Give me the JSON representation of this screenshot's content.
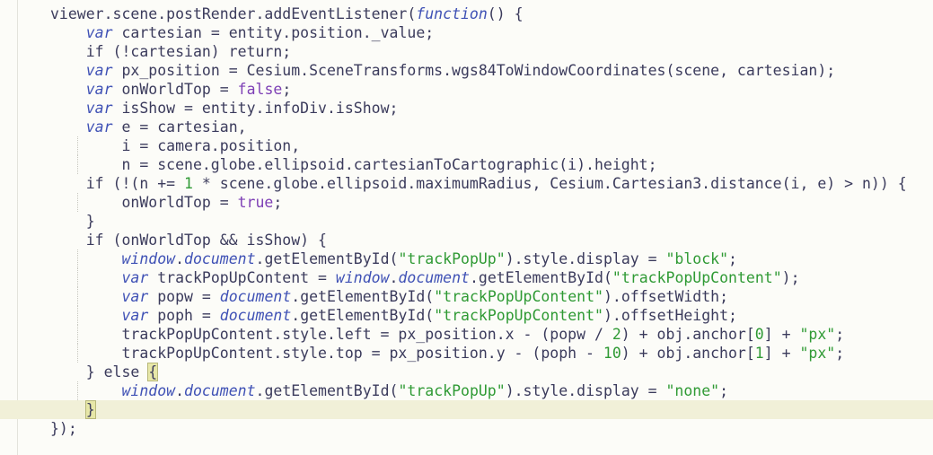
{
  "editor": {
    "lines": [
      [
        {
          "t": "plain",
          "s": "viewer.scene.postRender.addEventListener("
        },
        {
          "t": "kw",
          "s": "function"
        },
        {
          "t": "plain",
          "s": "() {"
        }
      ],
      [
        {
          "t": "plain",
          "s": "    "
        },
        {
          "t": "kw",
          "s": "var"
        },
        {
          "t": "plain",
          "s": " cartesian = entity.position._value;"
        }
      ],
      [
        {
          "t": "plain",
          "s": "    if (!cartesian) return;"
        }
      ],
      [
        {
          "t": "plain",
          "s": "    "
        },
        {
          "t": "kw",
          "s": "var"
        },
        {
          "t": "plain",
          "s": " px_position = Cesium.SceneTransforms.wgs84ToWindowCoordinates(scene, cartesian);"
        }
      ],
      [
        {
          "t": "plain",
          "s": "    "
        },
        {
          "t": "kw",
          "s": "var"
        },
        {
          "t": "plain",
          "s": " onWorldTop = "
        },
        {
          "t": "bool",
          "s": "false"
        },
        {
          "t": "plain",
          "s": ";"
        }
      ],
      [
        {
          "t": "plain",
          "s": "    "
        },
        {
          "t": "kw",
          "s": "var"
        },
        {
          "t": "plain",
          "s": " isShow = entity.infoDiv.isShow;"
        }
      ],
      [
        {
          "t": "plain",
          "s": "    "
        },
        {
          "t": "kw",
          "s": "var"
        },
        {
          "t": "plain",
          "s": " e = cartesian,"
        }
      ],
      [
        {
          "t": "plain",
          "s": "        i = camera.position,"
        }
      ],
      [
        {
          "t": "plain",
          "s": "        n = scene.globe.ellipsoid.cartesianToCartographic(i).height;"
        }
      ],
      [
        {
          "t": "plain",
          "s": "    if (!(n += "
        },
        {
          "t": "num",
          "s": "1"
        },
        {
          "t": "plain",
          "s": " * scene.globe.ellipsoid.maximumRadius, Cesium.Cartesian3.distance(i, e) > n)) {"
        }
      ],
      [
        {
          "t": "plain",
          "s": "        onWorldTop = "
        },
        {
          "t": "bool",
          "s": "true"
        },
        {
          "t": "plain",
          "s": ";"
        }
      ],
      [
        {
          "t": "plain",
          "s": "    }"
        }
      ],
      [
        {
          "t": "plain",
          "s": "    if (onWorldTop && isShow) {"
        }
      ],
      [
        {
          "t": "plain",
          "s": "        "
        },
        {
          "t": "obj",
          "s": "window"
        },
        {
          "t": "plain",
          "s": "."
        },
        {
          "t": "obj",
          "s": "document"
        },
        {
          "t": "plain",
          "s": ".getElementById("
        },
        {
          "t": "str",
          "s": "\"trackPopUp\""
        },
        {
          "t": "plain",
          "s": ").style.display = "
        },
        {
          "t": "str",
          "s": "\"block\""
        },
        {
          "t": "plain",
          "s": ";"
        }
      ],
      [
        {
          "t": "plain",
          "s": "        "
        },
        {
          "t": "kw",
          "s": "var"
        },
        {
          "t": "plain",
          "s": " trackPopUpContent = "
        },
        {
          "t": "obj",
          "s": "window"
        },
        {
          "t": "plain",
          "s": "."
        },
        {
          "t": "obj",
          "s": "document"
        },
        {
          "t": "plain",
          "s": ".getElementById("
        },
        {
          "t": "str",
          "s": "\"trackPopUpContent\""
        },
        {
          "t": "plain",
          "s": ");"
        }
      ],
      [
        {
          "t": "plain",
          "s": "        "
        },
        {
          "t": "kw",
          "s": "var"
        },
        {
          "t": "plain",
          "s": " popw = "
        },
        {
          "t": "obj",
          "s": "document"
        },
        {
          "t": "plain",
          "s": ".getElementById("
        },
        {
          "t": "str",
          "s": "\"trackPopUpContent\""
        },
        {
          "t": "plain",
          "s": ").offsetWidth;"
        }
      ],
      [
        {
          "t": "plain",
          "s": "        "
        },
        {
          "t": "kw",
          "s": "var"
        },
        {
          "t": "plain",
          "s": " poph = "
        },
        {
          "t": "obj",
          "s": "document"
        },
        {
          "t": "plain",
          "s": ".getElementById("
        },
        {
          "t": "str",
          "s": "\"trackPopUpContent\""
        },
        {
          "t": "plain",
          "s": ").offsetHeight;"
        }
      ],
      [
        {
          "t": "plain",
          "s": "        trackPopUpContent.style.left = px_position.x - (popw / "
        },
        {
          "t": "num",
          "s": "2"
        },
        {
          "t": "plain",
          "s": ") + obj.anchor["
        },
        {
          "t": "num",
          "s": "0"
        },
        {
          "t": "plain",
          "s": "] + "
        },
        {
          "t": "str",
          "s": "\"px\""
        },
        {
          "t": "plain",
          "s": ";"
        }
      ],
      [
        {
          "t": "plain",
          "s": "        trackPopUpContent.style.top = px_position.y - (poph - "
        },
        {
          "t": "num",
          "s": "10"
        },
        {
          "t": "plain",
          "s": ") + obj.anchor["
        },
        {
          "t": "num",
          "s": "1"
        },
        {
          "t": "plain",
          "s": "] + "
        },
        {
          "t": "str",
          "s": "\"px\""
        },
        {
          "t": "plain",
          "s": ";"
        }
      ],
      [
        {
          "t": "plain",
          "s": "    } else "
        },
        {
          "t": "brace",
          "s": "{"
        }
      ],
      [
        {
          "t": "plain",
          "s": "        "
        },
        {
          "t": "obj",
          "s": "window"
        },
        {
          "t": "plain",
          "s": "."
        },
        {
          "t": "obj",
          "s": "document"
        },
        {
          "t": "plain",
          "s": ".getElementById("
        },
        {
          "t": "str",
          "s": "\"trackPopUp\""
        },
        {
          "t": "plain",
          "s": ").style.display = "
        },
        {
          "t": "str",
          "s": "\"none\""
        },
        {
          "t": "plain",
          "s": ";"
        }
      ],
      [
        {
          "t": "plain",
          "s": "    "
        },
        {
          "t": "brace",
          "s": "}"
        },
        {
          "t": "caret",
          "s": ""
        }
      ],
      [
        {
          "t": "plain",
          "s": "});"
        }
      ]
    ],
    "current_line_index": 21
  }
}
